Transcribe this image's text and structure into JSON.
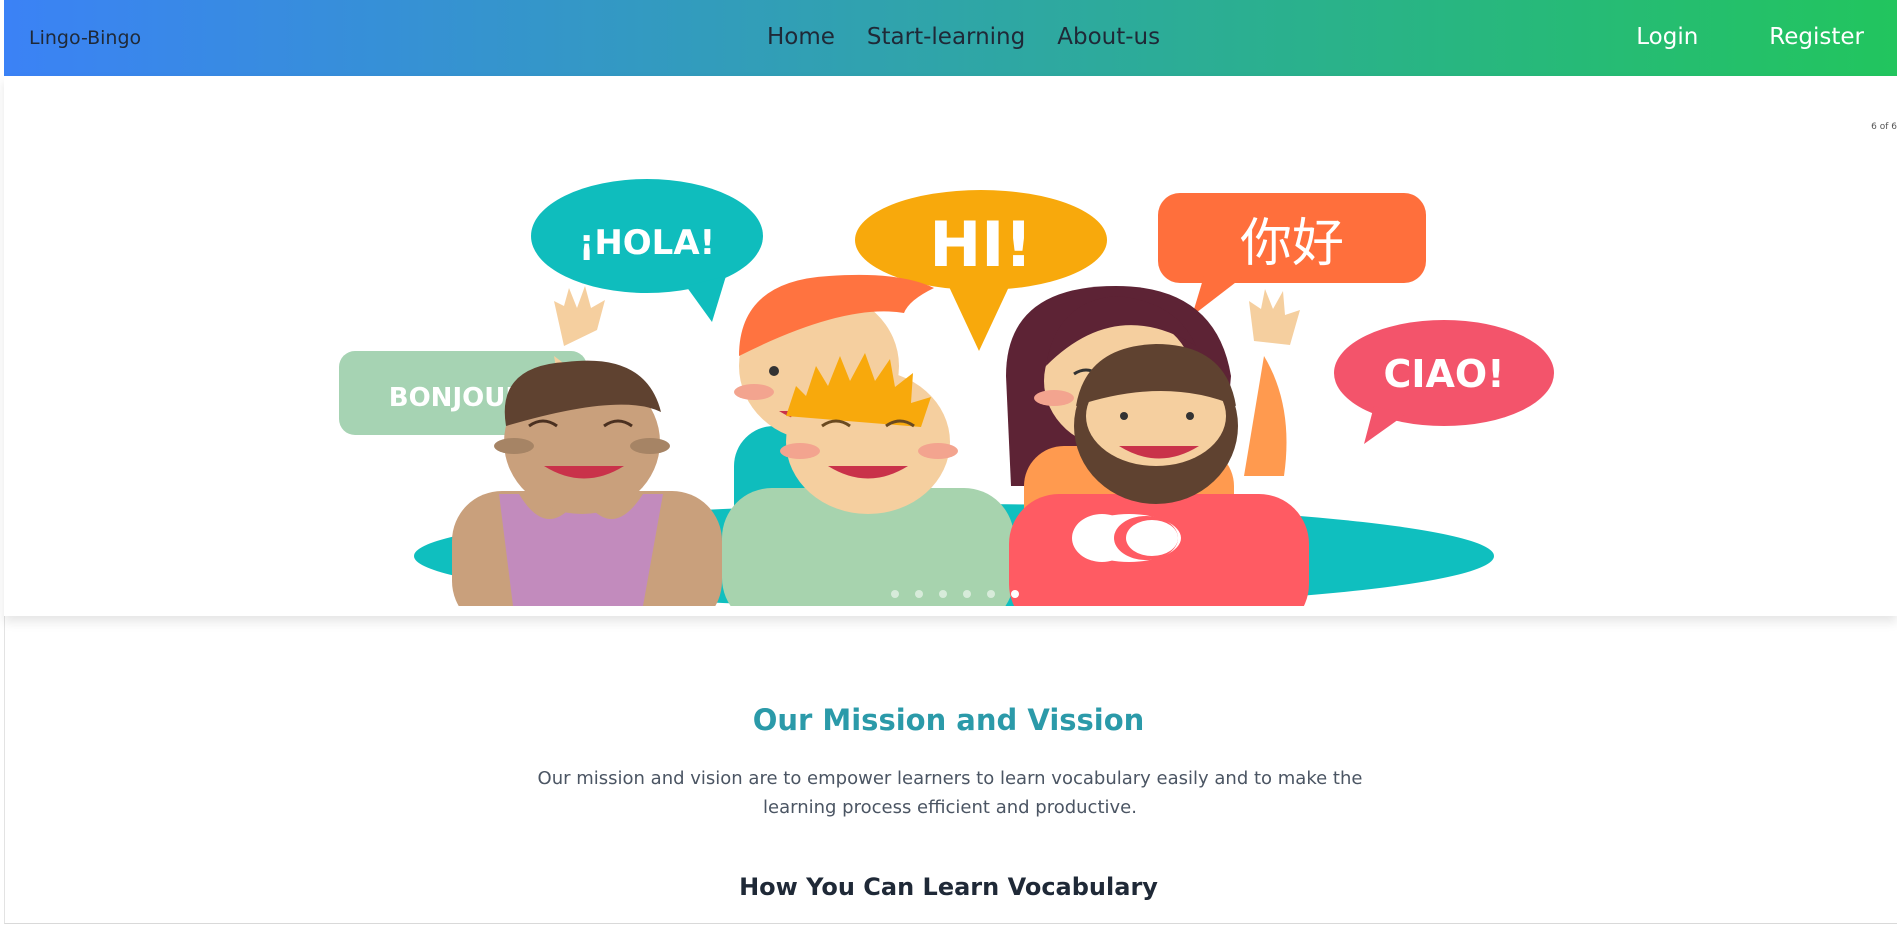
{
  "navbar": {
    "brand": "Lingo-Bingo",
    "links": [
      "Home",
      "Start-learning",
      "About-us"
    ],
    "login": "Login",
    "register": "Register"
  },
  "carousel": {
    "counter": "6 of 6",
    "total_slides": 6,
    "active_slide": 6,
    "speech_bubbles": [
      "¡HOLA!",
      "HI!",
      "你好",
      "BONJOUR!",
      "CIAO!"
    ]
  },
  "mission": {
    "title": "Our Mission and Vission",
    "text": "Our mission and vision are to empower learners to learn vocabulary easily and to make the learning process efficient and productive."
  },
  "how": {
    "title": "How You Can Learn Vocabulary"
  }
}
